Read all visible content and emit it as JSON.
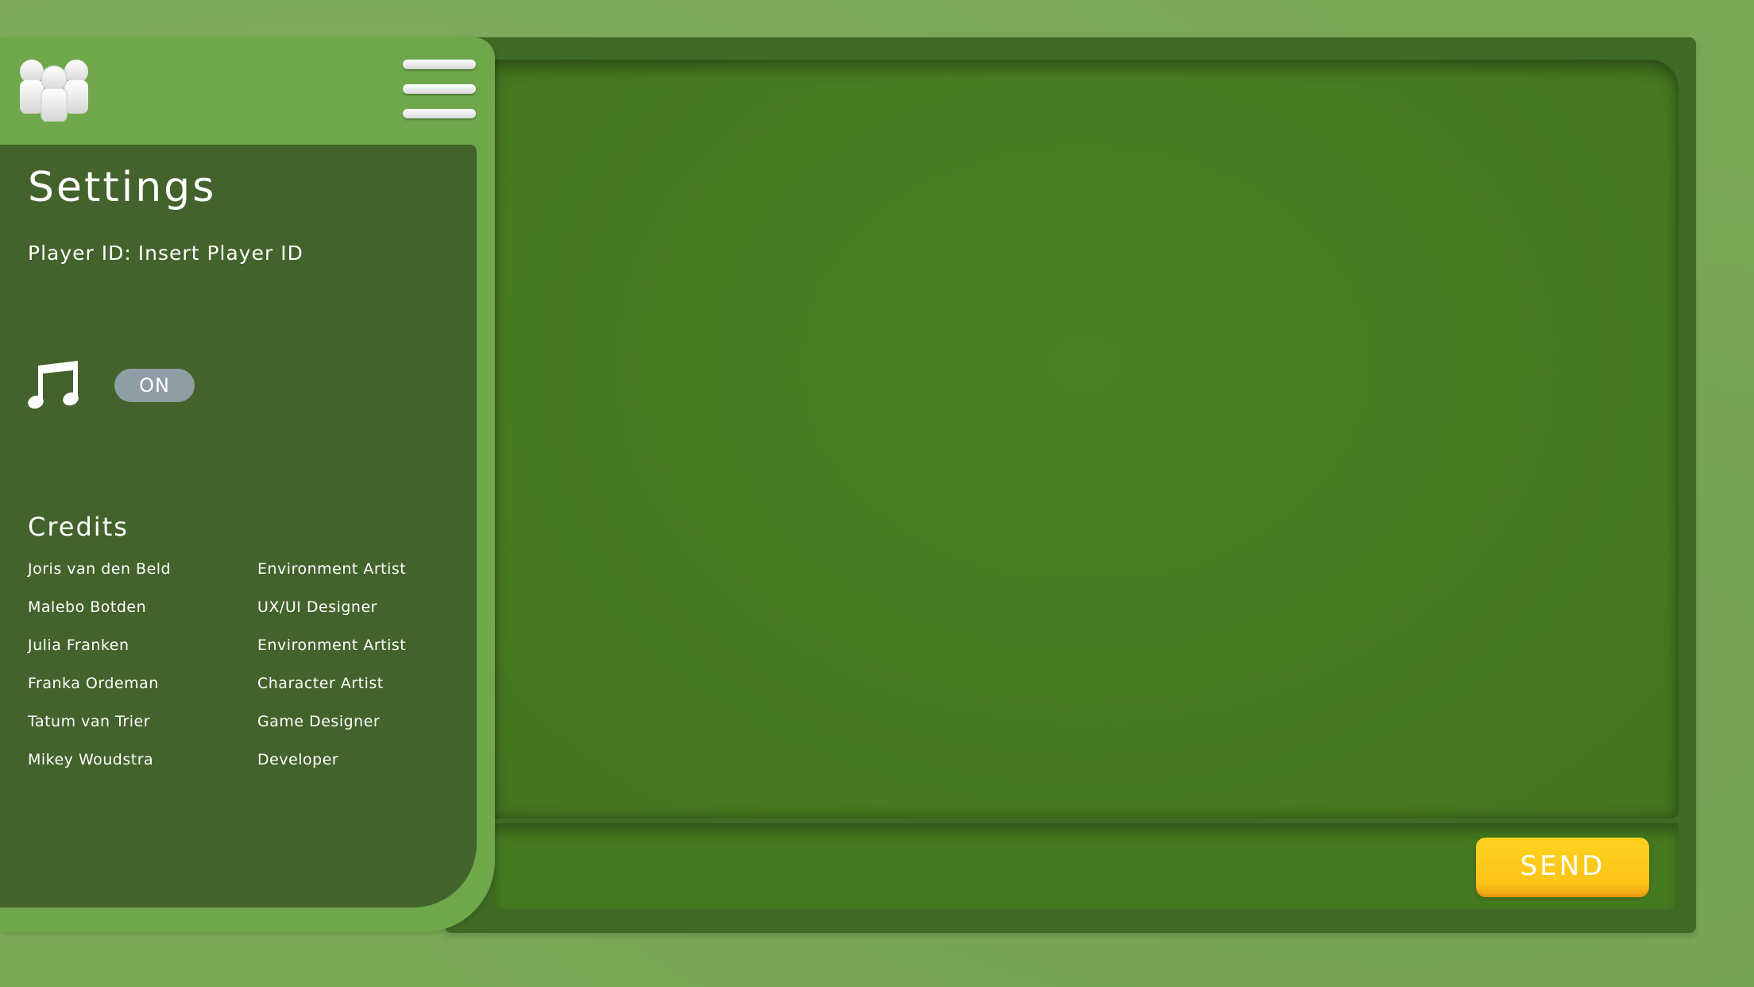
{
  "settings": {
    "title": "Settings",
    "player_id_label": "Player ID:",
    "player_id_value": "Insert Player ID",
    "music": {
      "icon": "music-note-icon",
      "toggle_label": "ON"
    },
    "credits": {
      "title": "Credits",
      "people": [
        {
          "name": "Joris van den Beld",
          "role": "Environment Artist"
        },
        {
          "name": "Malebo Botden",
          "role": "UX/UI Designer"
        },
        {
          "name": "Julia Franken",
          "role": "Environment Artist"
        },
        {
          "name": "Franka Ordeman",
          "role": "Character Artist"
        },
        {
          "name": "Tatum van Trier",
          "role": "Game Designer"
        },
        {
          "name": "Mikey Woudstra",
          "role": "Developer"
        }
      ]
    }
  },
  "header": {
    "friends_icon": "friends-icon",
    "menu_icon": "hamburger-menu-icon"
  },
  "chat": {
    "send_label": "SEND"
  },
  "colors": {
    "background": "#79a857",
    "panel": "#6ea84b",
    "settings_card": "#43622c",
    "board": "#3f6a24",
    "chat_area": "#477b21",
    "send_button": "#fbc417",
    "toggle": "#8f9ea5"
  }
}
